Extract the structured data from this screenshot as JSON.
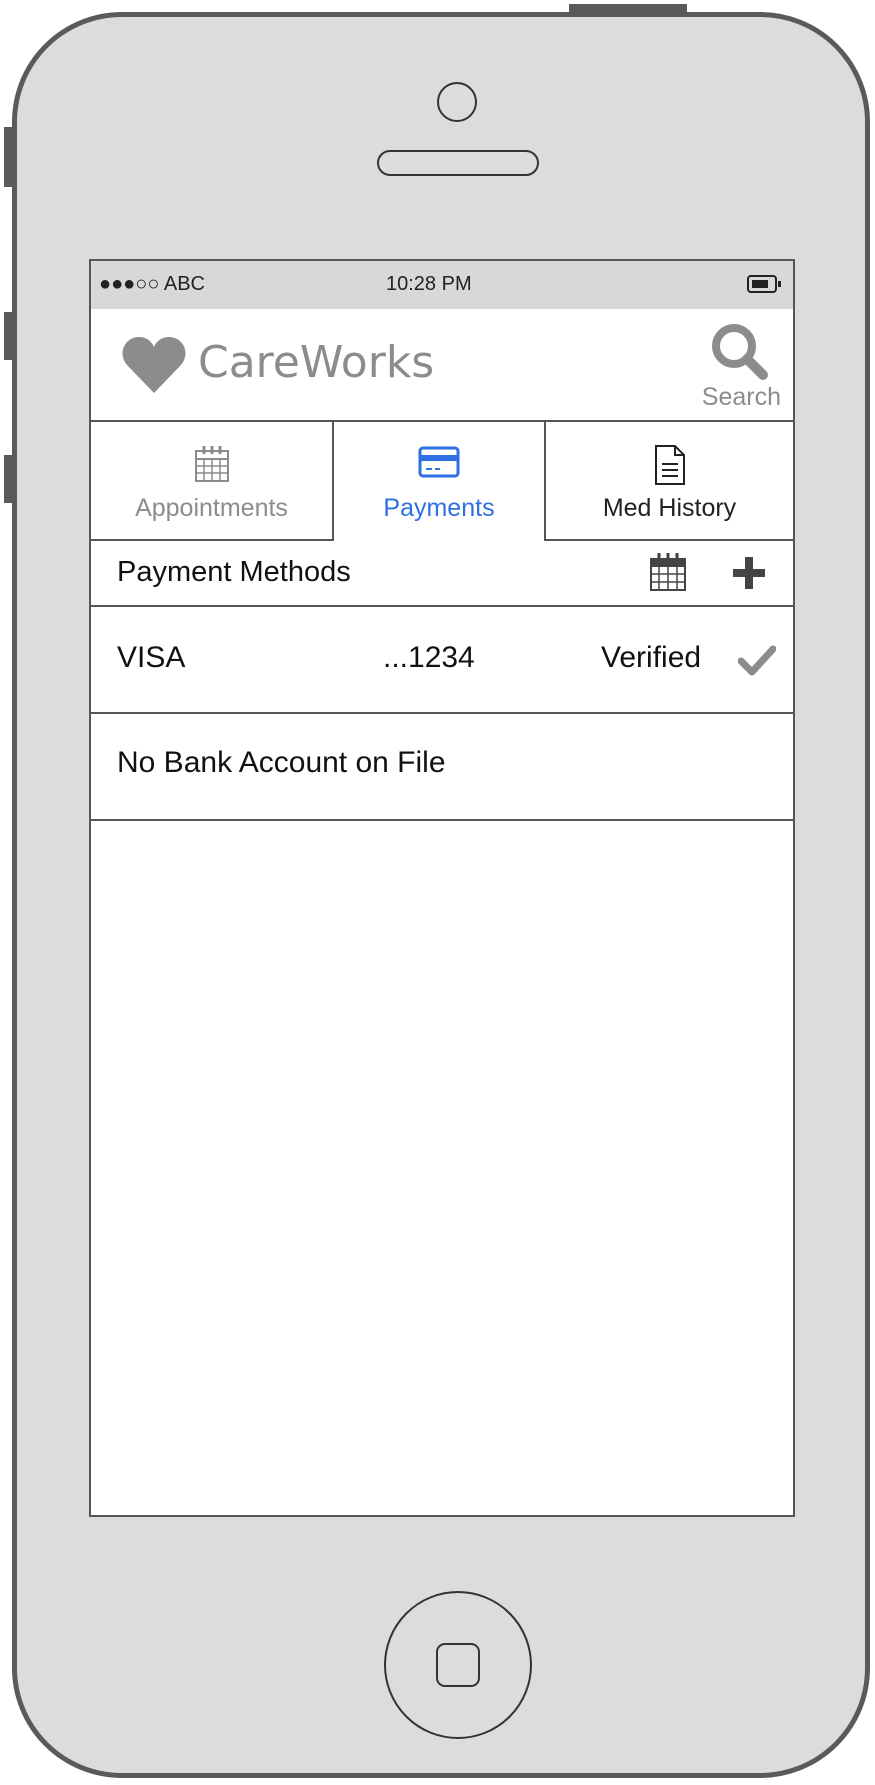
{
  "status_bar": {
    "signal": "●●●○○ ABC",
    "time": "10:28 PM"
  },
  "header": {
    "logo_icon": "heart-icon",
    "app_name": "CareWorks",
    "search_label": "Search",
    "search_icon": "search-icon"
  },
  "tabs": [
    {
      "label": "Appointments",
      "icon": "calendar-icon",
      "active": false
    },
    {
      "label": "Payments",
      "icon": "credit-card-icon",
      "active": true
    },
    {
      "label": "Med History",
      "icon": "document-icon",
      "active": false
    }
  ],
  "section": {
    "title": "Payment Methods",
    "calendar_icon": "calendar-icon",
    "add_icon": "plus-icon"
  },
  "payment_methods": [
    {
      "brand": "VISA",
      "number": "...1234",
      "status": "Verified",
      "status_icon": "check-icon"
    }
  ],
  "bank_message": "No Bank Account on File",
  "colors": {
    "active_tab": "#2f6fe4",
    "muted": "#8c8c8c",
    "device_body": "#dcdcdc"
  }
}
